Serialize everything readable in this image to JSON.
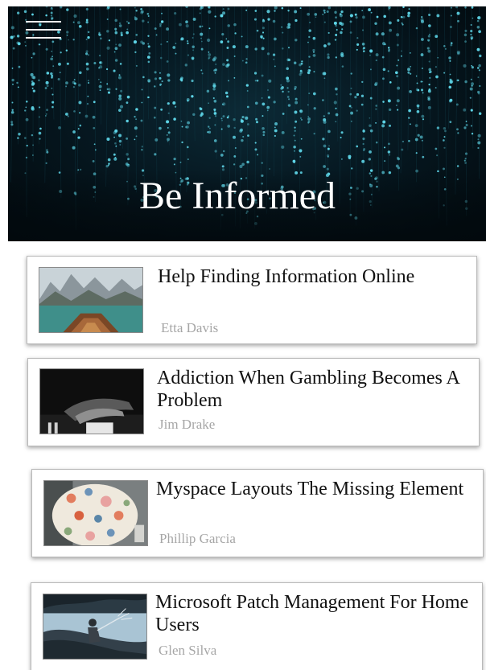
{
  "header": {
    "menu_icon": "hamburger-menu-icon",
    "title": "Be Informed"
  },
  "articles": [
    {
      "title": "Help Finding Information Online",
      "author": "Etta Davis",
      "thumbnail": "lake-boat-image"
    },
    {
      "title": "Addiction When Gambling Becomes A Problem",
      "author": "Jim Drake",
      "thumbnail": "piano-hands-image"
    },
    {
      "title": "Myspace Layouts The Missing Element",
      "author": "Phillip Garcia",
      "thumbnail": "floral-fabric-image"
    },
    {
      "title": "Microsoft Patch Management For Home Users",
      "author": "Glen Silva",
      "thumbnail": "river-person-image"
    }
  ],
  "colors": {
    "hero_background": "#02090d",
    "hero_lights": "#5fd8ea",
    "title_text": "#ffffff",
    "card_title": "#111111",
    "card_author": "#a6a6a6",
    "card_border": "#b9b9b9"
  }
}
